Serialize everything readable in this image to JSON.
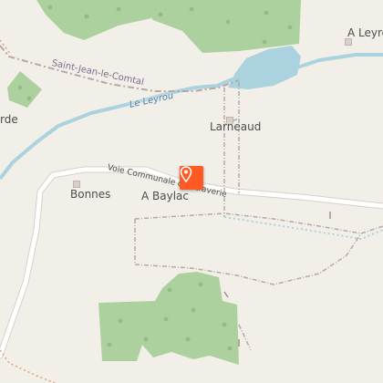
{
  "map": {
    "labels": {
      "river": "Le Leyrou",
      "rail_track": "Saint-Jean-le-Comtal",
      "road": "Voie Communale d'Entraverie",
      "larneaud": "Larneaud",
      "bonnes": "Bonnes",
      "baylac": "A Baylac",
      "leyrou_place": "A Leyro",
      "rde_fragment": "rde"
    },
    "colors": {
      "background": "#f2efe9",
      "forest": "#add19e",
      "water": "#aad3df",
      "road": "#ffffff",
      "marker": "#ff5a24",
      "track": "#b5a9a3"
    },
    "marker": {
      "icon": "map-pin-icon"
    }
  }
}
